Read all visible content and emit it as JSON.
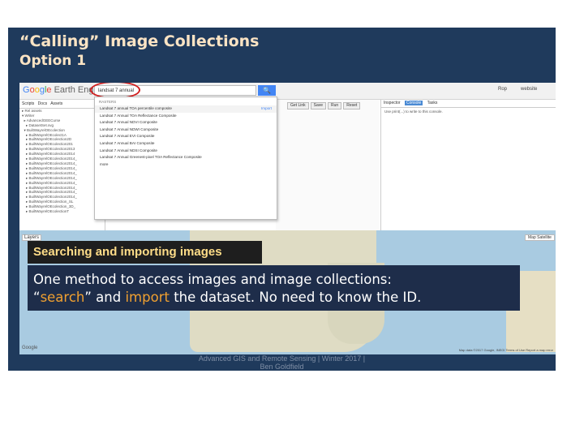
{
  "slide": {
    "title_line1": "“Calling” Image Collections",
    "title_line2": "Option 1"
  },
  "gee": {
    "logo_g1": "G",
    "logo_o1": "o",
    "logo_o2": "o",
    "logo_g2": "g",
    "logo_l": "l",
    "logo_e": "e",
    "logo_suffix": " Earth Engine",
    "search_value": "landsat 7 annual",
    "search_icon": "🔍",
    "header_right_1": "Rop",
    "header_right_2": "website",
    "left_tabs": [
      "Scripts",
      "Docs",
      "Assets"
    ],
    "tree_items": [
      "▸ Rel assets",
      "▾ Writer",
      "  ▸ AdvancedGEECurse",
      "    ▸ DatasetSet.svg",
      "  ▾ BuiltWayrelOEcolection",
      "    ▸ BuiltWayrelOEcolect1A",
      "    ▸ BuiltWayrelOEcolection2D",
      "    ▸ BuiltWayrelOEcolection201",
      "    ▸ BuiltWayrelOEcolection2013",
      "    ▸ BuiltWayrelOEcolection2014",
      "    ▸ BuiltWayrelOEcolection2014_",
      "    ▸ BuiltWayrelOEcolection2014_",
      "    ▸ BuiltWayrelOEcolection2014_",
      "    ▸ BuiltWayrelOEcolection2014_",
      "    ▸ BuiltWayrelOEcolection2014_",
      "    ▸ BuiltWayrelOEcolection2014_",
      "    ▸ BuiltWayrelOEcolection2014_",
      "    ▸ BuiltWayrelOEcolection2014_",
      "    ▸ BuiltWayrelOEcolection2014_",
      "    ▸ BuiltWayrelOEcolection_SL",
      "    ▸ BuiltWayrelOEcolection_3D_",
      "    ▸ BuiltWayrelOEcolectionT"
    ],
    "dropdown_header": "RASTERS",
    "dropdown_rows": [
      "Landsat 7 annual TOA percentile composite",
      "Landsat 7 Annual TOA Reflectance Composite",
      "Landsat 7 Annual NDVI Composite",
      "Landsat 7 Annual NDWI Composite",
      "Landsat 7 Annual EVI Composite",
      "Landsat 7 Annual BAI Composite",
      "Landsat 7 Annual NDSI Composite",
      "Landsat 7 Annual Greenest-pixel TOA Reflectance Composite",
      "more"
    ],
    "import_label": "Import",
    "editor_buttons": [
      "Get Link",
      "Save",
      "Run",
      "Reset"
    ],
    "right_tabs": [
      "Inspector",
      "Console",
      "Tasks"
    ],
    "right_text": "Use print(...) to write to this console.",
    "map_layers": "Layers",
    "map_type": "Map  Satellite",
    "google_mark": "Google",
    "attribution": "Map data ©2017 Google, INEGI   Terms of Use   Report a map error"
  },
  "overlay": {
    "title": "Searching and importing images",
    "body_line1": "One method to access images and image collections:",
    "q_open": "“",
    "search_word": "search",
    "mid_text": "” and ",
    "import_word": "import",
    "body_end": " the dataset. No need to know the ID."
  },
  "footer": {
    "line1": "Advanced GIS and Remote Sensing | Winter 2017 |",
    "line2": "Ben Goldfield"
  },
  "colors": {
    "slide_bg": "#1f3a5c",
    "title_text": "#fce4c4",
    "highlight": "#f0a030",
    "search_circle": "#d21f1f",
    "gee_blue": "#4285f4"
  }
}
